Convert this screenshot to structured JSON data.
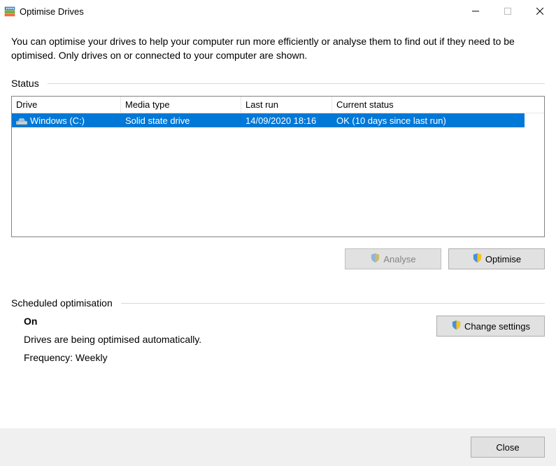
{
  "window": {
    "title": "Optimise Drives"
  },
  "description": "You can optimise your drives to help your computer run more efficiently or analyse them to find out if they need to be optimised. Only drives on or connected to your computer are shown.",
  "status_section_label": "Status",
  "columns": {
    "drive": "Drive",
    "media": "Media type",
    "last": "Last run",
    "status": "Current status"
  },
  "drives": [
    {
      "name": "Windows (C:)",
      "media": "Solid state drive",
      "last_run": "14/09/2020 18:16",
      "status": "OK (10 days since last run)"
    }
  ],
  "buttons": {
    "analyse": "Analyse",
    "optimise": "Optimise",
    "change_settings": "Change settings",
    "close": "Close"
  },
  "scheduled": {
    "section_label": "Scheduled optimisation",
    "state": "On",
    "desc": "Drives are being optimised automatically.",
    "freq": "Frequency: Weekly"
  }
}
